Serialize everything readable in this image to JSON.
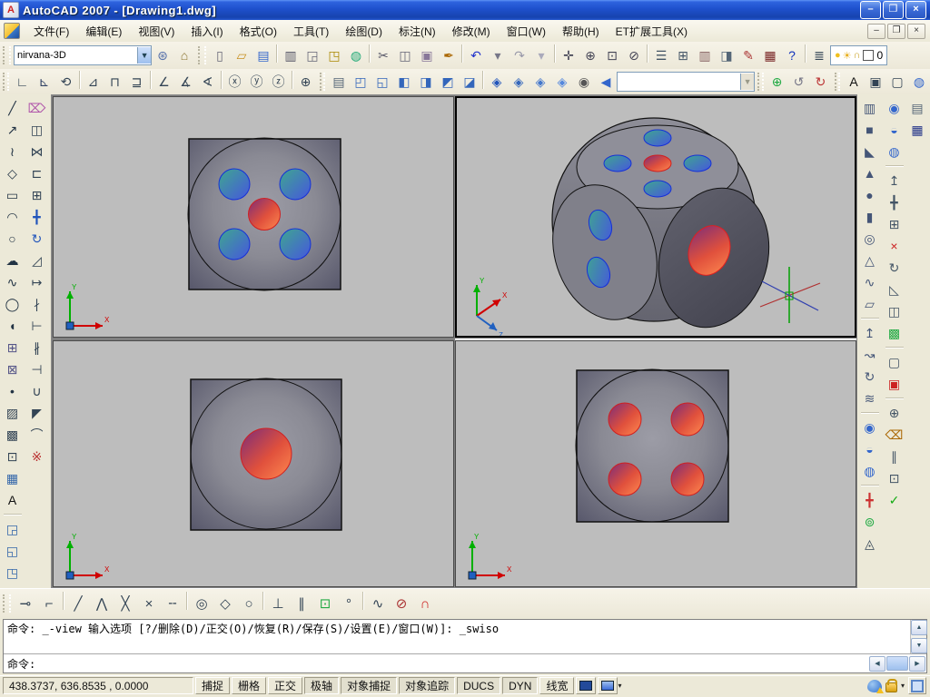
{
  "window": {
    "title": "AutoCAD 2007 - [Drawing1.dwg]",
    "controls": [
      {
        "name": "minimize-button",
        "glyph": "–"
      },
      {
        "name": "restore-button",
        "glyph": "❐"
      },
      {
        "name": "close-button",
        "glyph": "×"
      }
    ],
    "mdi_controls": [
      {
        "name": "mdi-minimize-button",
        "glyph": "–"
      },
      {
        "name": "mdi-restore-button",
        "glyph": "❐"
      },
      {
        "name": "mdi-close-button",
        "glyph": "×"
      }
    ]
  },
  "menu": {
    "items": [
      {
        "name": "menu-file",
        "label": "文件(F)"
      },
      {
        "name": "menu-edit",
        "label": "编辑(E)"
      },
      {
        "name": "menu-view",
        "label": "视图(V)"
      },
      {
        "name": "menu-insert",
        "label": "插入(I)"
      },
      {
        "name": "menu-format",
        "label": "格式(O)"
      },
      {
        "name": "menu-tools",
        "label": "工具(T)"
      },
      {
        "name": "menu-draw",
        "label": "绘图(D)"
      },
      {
        "name": "menu-dimension",
        "label": "标注(N)"
      },
      {
        "name": "menu-modify",
        "label": "修改(M)"
      },
      {
        "name": "menu-window",
        "label": "窗口(W)"
      },
      {
        "name": "menu-help",
        "label": "帮助(H)"
      },
      {
        "name": "menu-express-tools",
        "label": "ET扩展工具(X)"
      }
    ]
  },
  "toolbar1": {
    "workspace_combo": {
      "value": "nirvana-3D"
    },
    "workspace_icons": [
      {
        "name": "workspace-settings",
        "glyph": "⊛",
        "color": "#5570aa"
      },
      {
        "name": "my-workspace",
        "glyph": "⌂",
        "color": "#8a7430"
      }
    ],
    "standard_icons": [
      {
        "name": "new-file",
        "glyph": "▯",
        "color": "#667"
      },
      {
        "name": "open-file",
        "glyph": "▱",
        "color": "#c89020"
      },
      {
        "name": "save-file",
        "glyph": "▤",
        "color": "#3366cc"
      },
      {
        "sep": true
      },
      {
        "name": "plot",
        "glyph": "▥",
        "color": "#556"
      },
      {
        "name": "plot-preview",
        "glyph": "◲",
        "color": "#667"
      },
      {
        "name": "publish",
        "glyph": "◳",
        "color": "#aa8800"
      },
      {
        "name": "3d-dwf",
        "glyph": "◍",
        "color": "#22aa77"
      },
      {
        "sep": true
      },
      {
        "name": "cut",
        "glyph": "✂",
        "color": "#556"
      },
      {
        "name": "copy-clip",
        "glyph": "◫",
        "color": "#667"
      },
      {
        "name": "paste",
        "glyph": "▣",
        "color": "#887799"
      },
      {
        "name": "match-properties",
        "glyph": "✒",
        "color": "#aa6600"
      },
      {
        "sep": true
      },
      {
        "name": "undo",
        "glyph": "↶",
        "color": "#2233cc"
      },
      {
        "name": "undo-dropdown",
        "glyph": "▾",
        "color": "#778"
      },
      {
        "name": "redo",
        "glyph": "↷",
        "color": "#99a"
      },
      {
        "name": "redo-dropdown",
        "glyph": "▾",
        "color": "#aab"
      },
      {
        "sep": true
      },
      {
        "name": "pan-realtime",
        "glyph": "✛",
        "color": "#445"
      },
      {
        "name": "zoom-realtime",
        "glyph": "⊕",
        "color": "#445"
      },
      {
        "name": "zoom-window",
        "glyph": "⊡",
        "color": "#445"
      },
      {
        "name": "zoom-previous",
        "glyph": "⊘",
        "color": "#445"
      },
      {
        "sep": true
      },
      {
        "name": "properties-palette",
        "glyph": "☰",
        "color": "#456"
      },
      {
        "name": "designcenter",
        "glyph": "⊞",
        "color": "#456"
      },
      {
        "name": "tool-palettes",
        "glyph": "▥",
        "color": "#856060"
      },
      {
        "name": "sheet-set-manager",
        "glyph": "◨",
        "color": "#567"
      },
      {
        "name": "markup-set-manager",
        "glyph": "✎",
        "color": "#aa3333"
      },
      {
        "name": "quickcalc",
        "glyph": "▦",
        "color": "#772222"
      },
      {
        "name": "help",
        "glyph": "?",
        "color": "#1133bb"
      },
      {
        "sep": true
      },
      {
        "name": "layer-properties-manager",
        "glyph": "≣",
        "color": "#345"
      }
    ],
    "layer_status_icons": [
      {
        "name": "layer-on-bulb",
        "glyph": "●",
        "color": "#f0c020"
      },
      {
        "name": "layer-freeze-sun",
        "glyph": "☀",
        "color": "#e8b020"
      },
      {
        "name": "layer-lock",
        "glyph": "∩",
        "color": "#c8a020"
      }
    ]
  },
  "layer": {
    "current": "0"
  },
  "toolbar2": {
    "ucs_icons": [
      {
        "name": "ucs",
        "glyph": "∟",
        "color": "#345"
      },
      {
        "name": "world-ucs",
        "glyph": "⊾",
        "color": "#346"
      },
      {
        "name": "previous-ucs",
        "glyph": "⟲",
        "color": "#345"
      },
      {
        "sep": true
      },
      {
        "name": "face-ucs",
        "glyph": "⊿",
        "color": "#345"
      },
      {
        "name": "object-ucs",
        "glyph": "⊓",
        "color": "#345"
      },
      {
        "name": "view-ucs",
        "glyph": "⊒",
        "color": "#345"
      },
      {
        "sep": true
      },
      {
        "name": "origin-ucs",
        "glyph": "∠",
        "color": "#345"
      },
      {
        "name": "zaxis-vector-ucs",
        "glyph": "∡",
        "color": "#345"
      },
      {
        "name": "3point-ucs",
        "glyph": "∢",
        "color": "#345"
      },
      {
        "sep": true
      },
      {
        "name": "rotate-x-ucs",
        "glyph": "ⓧ",
        "color": "#345"
      },
      {
        "name": "rotate-y-ucs",
        "glyph": "ⓨ",
        "color": "#345"
      },
      {
        "name": "rotate-z-ucs",
        "glyph": "ⓩ",
        "color": "#345"
      },
      {
        "sep": true
      },
      {
        "name": "apply-ucs",
        "glyph": "⊕",
        "color": "#345"
      }
    ],
    "view_icons": [
      {
        "name": "named-views",
        "glyph": "▤",
        "color": "#567"
      },
      {
        "name": "top-view",
        "glyph": "◰",
        "color": "#3366bb"
      },
      {
        "name": "bottom-view",
        "glyph": "◱",
        "color": "#3366bb"
      },
      {
        "name": "left-view",
        "glyph": "◧",
        "color": "#3366bb"
      },
      {
        "name": "right-view",
        "glyph": "◨",
        "color": "#3366bb"
      },
      {
        "name": "front-view",
        "glyph": "◩",
        "color": "#3366bb"
      },
      {
        "name": "back-view",
        "glyph": "◪",
        "color": "#3366bb"
      },
      {
        "sep": true
      },
      {
        "name": "sw-isometric-view",
        "glyph": "◈",
        "color": "#2255bb"
      },
      {
        "name": "se-isometric-view",
        "glyph": "◈",
        "color": "#3366bb"
      },
      {
        "name": "ne-isometric-view",
        "glyph": "◈",
        "color": "#4477cc"
      },
      {
        "name": "nw-isometric-view",
        "glyph": "◈",
        "color": "#5588dd"
      },
      {
        "name": "camera",
        "glyph": "◉",
        "color": "#555"
      }
    ],
    "named_view_back": [
      {
        "name": "named-view-back",
        "glyph": "◀",
        "color": "#3366cc"
      }
    ],
    "view_combo": {
      "value": ""
    },
    "orbit_icons": [
      {
        "name": "3d-orbit",
        "glyph": "⊕",
        "color": "#22aa44"
      },
      {
        "name": "3d-swivel",
        "glyph": "↺",
        "color": "#778"
      },
      {
        "name": "3d-continuous-orbit",
        "glyph": "↻",
        "color": "#bb3333"
      }
    ],
    "style_icons": [
      {
        "name": "text-style",
        "glyph": "A",
        "color": "#111"
      },
      {
        "name": "box-modeling",
        "glyph": "▣",
        "color": "#345"
      },
      {
        "name": "wireframe-box",
        "glyph": "▢",
        "color": "#345"
      },
      {
        "name": "sphere-modeling",
        "glyph": "◍",
        "color": "#3366cc"
      }
    ]
  },
  "left_toolbar": {
    "draw": [
      {
        "name": "line",
        "glyph": "╱",
        "color": "#234"
      },
      {
        "name": "construction-line",
        "glyph": "↗",
        "color": "#234"
      },
      {
        "name": "polyline",
        "glyph": "≀",
        "color": "#234"
      },
      {
        "name": "polygon",
        "glyph": "◇",
        "color": "#234"
      },
      {
        "name": "rectangle",
        "glyph": "▭",
        "color": "#234"
      },
      {
        "name": "arc",
        "glyph": "◠",
        "color": "#234"
      },
      {
        "name": "circle",
        "glyph": "○",
        "color": "#234"
      },
      {
        "name": "revision-cloud",
        "glyph": "☁",
        "color": "#234"
      },
      {
        "name": "spline",
        "glyph": "∿",
        "color": "#234"
      },
      {
        "name": "ellipse",
        "glyph": "◯",
        "color": "#234"
      },
      {
        "name": "ellipse-arc",
        "glyph": "◖",
        "color": "#234"
      },
      {
        "name": "insert-block",
        "glyph": "⊞",
        "color": "#558"
      },
      {
        "name": "make-block",
        "glyph": "⊠",
        "color": "#558"
      },
      {
        "name": "point",
        "glyph": "•",
        "color": "#234"
      },
      {
        "name": "hatch",
        "glyph": "▨",
        "color": "#345"
      },
      {
        "name": "gradient",
        "glyph": "▩",
        "color": "#345"
      },
      {
        "name": "region",
        "glyph": "⊡",
        "color": "#345"
      },
      {
        "name": "table",
        "glyph": "▦",
        "color": "#3366aa"
      },
      {
        "name": "multiline-text",
        "glyph": "A",
        "color": "#111"
      },
      {
        "sep": true
      },
      {
        "name": "draworder-bring-to-front",
        "glyph": "◲",
        "color": "#3366aa"
      },
      {
        "name": "draworder-send-to-back",
        "glyph": "◱",
        "color": "#3366aa"
      },
      {
        "name": "draworder-bring-above",
        "glyph": "◳",
        "color": "#3366aa"
      },
      {
        "name": "draworder-send-under",
        "glyph": "◰",
        "color": "#3366aa"
      }
    ],
    "modify": [
      {
        "name": "erase",
        "glyph": "⌦",
        "color": "#b055aa"
      },
      {
        "name": "copy",
        "glyph": "◫",
        "color": "#345"
      },
      {
        "name": "mirror",
        "glyph": "⋈",
        "color": "#345"
      },
      {
        "name": "offset",
        "glyph": "⊏",
        "color": "#345"
      },
      {
        "name": "array",
        "glyph": "⊞",
        "color": "#345"
      },
      {
        "name": "move",
        "glyph": "╋",
        "color": "#2255bb"
      },
      {
        "name": "rotate",
        "glyph": "↻",
        "color": "#2255bb"
      },
      {
        "name": "scale",
        "glyph": "◿",
        "color": "#345"
      },
      {
        "name": "stretch",
        "glyph": "↦",
        "color": "#345"
      },
      {
        "name": "trim",
        "glyph": "∤",
        "color": "#345"
      },
      {
        "name": "extend",
        "glyph": "⊢",
        "color": "#345"
      },
      {
        "name": "break",
        "glyph": "∦",
        "color": "#345"
      },
      {
        "name": "break-at-point",
        "glyph": "⊣",
        "color": "#345"
      },
      {
        "name": "join",
        "glyph": "∪",
        "color": "#345"
      },
      {
        "name": "chamfer",
        "glyph": "◤",
        "color": "#345"
      },
      {
        "name": "fillet",
        "glyph": "⌒",
        "color": "#345"
      },
      {
        "name": "explode",
        "glyph": "※",
        "color": "#bb3333"
      }
    ]
  },
  "right_toolbar": {
    "modeling": [
      {
        "name": "polysolid",
        "glyph": "▥",
        "color": "#457"
      },
      {
        "name": "box",
        "glyph": "■",
        "color": "#457"
      },
      {
        "name": "wedge",
        "glyph": "◣",
        "color": "#457"
      },
      {
        "name": "cone",
        "glyph": "▲",
        "color": "#457"
      },
      {
        "name": "sphere",
        "glyph": "●",
        "color": "#457"
      },
      {
        "name": "cylinder",
        "glyph": "▮",
        "color": "#457"
      },
      {
        "name": "torus",
        "glyph": "◎",
        "color": "#457"
      },
      {
        "name": "pyramid",
        "glyph": "△",
        "color": "#457"
      },
      {
        "name": "helix",
        "glyph": "∿",
        "color": "#457"
      },
      {
        "name": "planar-surface",
        "glyph": "▱",
        "color": "#457"
      },
      {
        "sep": true
      },
      {
        "name": "extrude",
        "glyph": "↥",
        "color": "#457"
      },
      {
        "name": "sweep",
        "glyph": "↝",
        "color": "#457"
      },
      {
        "name": "revolve",
        "glyph": "↻",
        "color": "#457"
      },
      {
        "name": "loft",
        "glyph": "≋",
        "color": "#457"
      },
      {
        "sep": true
      },
      {
        "name": "union",
        "glyph": "◉",
        "color": "#3366cc"
      },
      {
        "name": "subtract",
        "glyph": "◒",
        "color": "#3366cc"
      },
      {
        "name": "intersect",
        "glyph": "◍",
        "color": "#3366cc"
      },
      {
        "sep": true
      },
      {
        "name": "3d-move",
        "glyph": "╋",
        "color": "#cc3333"
      },
      {
        "name": "3d-rotate",
        "glyph": "⊚",
        "color": "#22aa44"
      },
      {
        "name": "3d-walk",
        "glyph": "◬",
        "color": "#345"
      }
    ],
    "solid_editing": [
      {
        "name": "union-solids",
        "glyph": "◉",
        "color": "#3366cc"
      },
      {
        "name": "subtract-solids",
        "glyph": "◒",
        "color": "#3366cc"
      },
      {
        "name": "intersect-solids",
        "glyph": "◍",
        "color": "#3366cc"
      },
      {
        "sep": true
      },
      {
        "name": "extrude-faces",
        "glyph": "↥",
        "color": "#456"
      },
      {
        "name": "move-faces",
        "glyph": "╋",
        "color": "#456"
      },
      {
        "name": "offset-faces",
        "glyph": "⊞",
        "color": "#456"
      },
      {
        "name": "delete-faces",
        "glyph": "×",
        "color": "#cc2222"
      },
      {
        "name": "rotate-faces",
        "glyph": "↻",
        "color": "#456"
      },
      {
        "name": "taper-faces",
        "glyph": "◺",
        "color": "#456"
      },
      {
        "name": "copy-faces",
        "glyph": "◫",
        "color": "#456"
      },
      {
        "name": "color-faces",
        "glyph": "▩",
        "color": "#22aa44"
      },
      {
        "sep": true
      },
      {
        "name": "copy-edges",
        "glyph": "▢",
        "color": "#456"
      },
      {
        "name": "color-edges",
        "glyph": "▣",
        "color": "#cc2222"
      },
      {
        "sep": true
      },
      {
        "name": "imprint",
        "glyph": "⊕",
        "color": "#456"
      },
      {
        "name": "clean",
        "glyph": "⌫",
        "color": "#aa6600"
      },
      {
        "name": "separate",
        "glyph": "∥",
        "color": "#456"
      },
      {
        "name": "shell",
        "glyph": "⊡",
        "color": "#456"
      },
      {
        "name": "check",
        "glyph": "✓",
        "color": "#11aa11"
      }
    ],
    "extra": [
      {
        "name": "render-presets",
        "glyph": "▤",
        "color": "#567"
      },
      {
        "name": "dashboard",
        "glyph": "▦",
        "color": "#223388"
      }
    ]
  },
  "osnap_toolbar": [
    {
      "name": "temporary-track-point",
      "glyph": "⊸",
      "color": "#345"
    },
    {
      "name": "snap-from",
      "glyph": "⌐",
      "color": "#345"
    },
    {
      "sep": true
    },
    {
      "name": "snap-endpoint",
      "glyph": "╱",
      "color": "#345"
    },
    {
      "name": "snap-midpoint",
      "glyph": "⋀",
      "color": "#345"
    },
    {
      "name": "snap-intersection",
      "glyph": "╳",
      "color": "#345"
    },
    {
      "name": "snap-apparent-intersection",
      "glyph": "×",
      "color": "#345"
    },
    {
      "name": "snap-extension",
      "glyph": "╌",
      "color": "#345"
    },
    {
      "sep": true
    },
    {
      "name": "snap-center",
      "glyph": "◎",
      "color": "#345"
    },
    {
      "name": "snap-quadrant",
      "glyph": "◇",
      "color": "#345"
    },
    {
      "name": "snap-tangent",
      "glyph": "○",
      "color": "#345"
    },
    {
      "sep": true
    },
    {
      "name": "snap-perpendicular",
      "glyph": "⊥",
      "color": "#345"
    },
    {
      "name": "snap-parallel",
      "glyph": "∥",
      "color": "#345"
    },
    {
      "name": "snap-insert",
      "glyph": "⊡",
      "color": "#22aa44"
    },
    {
      "name": "snap-node",
      "glyph": "°",
      "color": "#345"
    },
    {
      "sep": true
    },
    {
      "name": "snap-nearest",
      "glyph": "∿",
      "color": "#345"
    },
    {
      "name": "snap-none",
      "glyph": "⊘",
      "color": "#aa3333"
    },
    {
      "name": "osnap-settings",
      "glyph": "∩",
      "color": "#cc2222"
    }
  ],
  "command_line": {
    "history": [
      "命令: _-view 输入选项 [?/删除(D)/正交(O)/恢复(R)/保存(S)/设置(E)/窗口(W)]: _swiso"
    ],
    "prompt": "命令:"
  },
  "status_bar": {
    "coordinates": "438.3737, 636.8535 , 0.0000",
    "toggles": [
      {
        "name": "snap-toggle",
        "label": "捕捉",
        "on": false
      },
      {
        "name": "grid-toggle",
        "label": "栅格",
        "on": false
      },
      {
        "name": "ortho-toggle",
        "label": "正交",
        "on": false
      },
      {
        "name": "polar-toggle",
        "label": "极轴",
        "on": true
      },
      {
        "name": "osnap-toggle",
        "label": "对象捕捉",
        "on": true
      },
      {
        "name": "otrack-toggle",
        "label": "对象追踪",
        "on": true
      },
      {
        "name": "ducs-toggle",
        "label": "DUCS",
        "on": true
      },
      {
        "name": "dyn-toggle",
        "label": "DYN",
        "on": true
      },
      {
        "name": "lineweight-toggle",
        "label": "线宽",
        "on": false
      }
    ]
  },
  "viewports": {
    "top_left": {
      "view": "top",
      "die_face_pips": 5,
      "pip_colors": "4 blue corners, 1 red center"
    },
    "top_right": {
      "view": "sw-isometric",
      "top_face_pips": 5,
      "left_face_pips": 2,
      "right_face_pips": 1
    },
    "bottom_left": {
      "view": "front",
      "die_face_pips": 1,
      "pip_colors": "1 red center"
    },
    "bottom_right": {
      "view": "right",
      "die_face_pips": 4,
      "pip_colors": "4 red"
    }
  },
  "colors": {
    "titlebar_blue": "#1E50CC",
    "close_red": "#D95636",
    "toolbar_beige": "#ECE9D8",
    "viewport_gray": "#BDBDBD",
    "dice_gray": "#84848E",
    "pip_blue": "#4666E0",
    "pip_red": "#E0503C"
  }
}
